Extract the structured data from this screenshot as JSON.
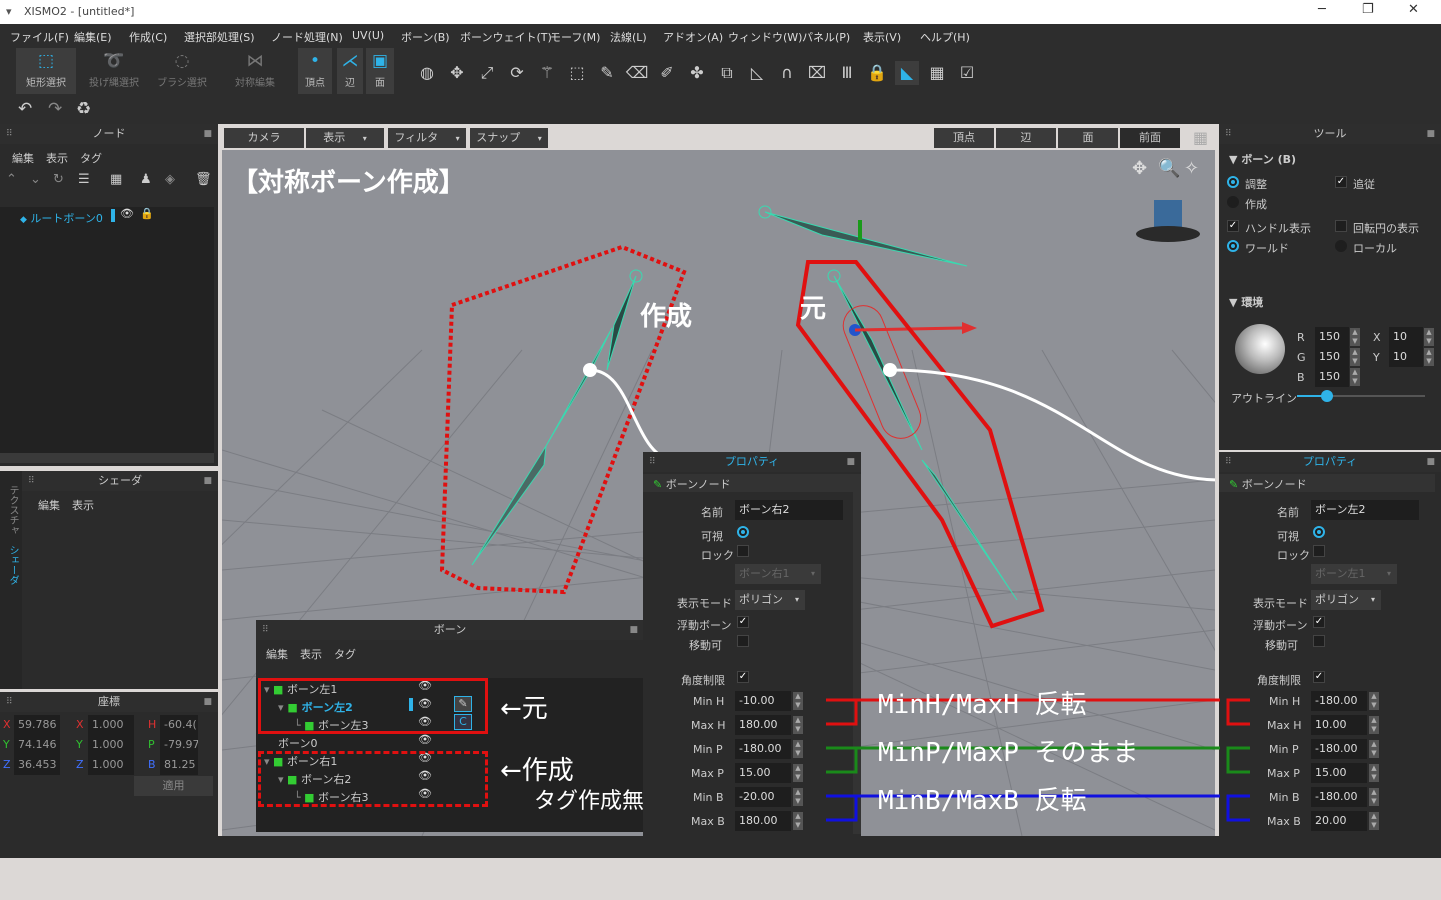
{
  "window": {
    "title": "XISMO2 - [untitled*]",
    "minimize": "─",
    "maximize": "❐",
    "close": "✕"
  },
  "menu": [
    "ファイル(F)",
    "編集(E)",
    "作成(C)",
    "選択部処理(S)",
    "ノード処理(N)",
    "UV(U)",
    "ボーン(B)",
    "ボーンウェイト(T)",
    "モーフ(M)",
    "法線(L)",
    "アドオン(A)",
    "ウィンドウ(W)",
    "パネル(P)",
    "表示(V)",
    "ヘルプ(H)"
  ],
  "toolbar": {
    "rect_select": "矩形選択",
    "lasso_select": "投げ縄選択",
    "brush_select": "ブラシ選択",
    "sym_edit": "対称編集",
    "vertex": "頂点",
    "edge": "辺",
    "face": "面"
  },
  "node_panel": {
    "title": "ノード",
    "menu": [
      "編集",
      "表示",
      "タグ"
    ],
    "root": "ルートボーン0"
  },
  "shader_panel": {
    "title": "シェーダ",
    "menu": [
      "編集",
      "表示"
    ],
    "side_tabs": [
      "テクスチャ",
      "シェーダ"
    ]
  },
  "coord_panel": {
    "title": "座標",
    "rows": [
      [
        "X",
        "59.786",
        "X",
        "1.000",
        "H",
        "-60.4("
      ],
      [
        "Y",
        "74.146",
        "Y",
        "1.000",
        "P",
        "-79.97"
      ],
      [
        "Z",
        "36.453",
        "Z",
        "1.000",
        "B",
        "81.25"
      ]
    ],
    "apply": "適用"
  },
  "viewport": {
    "tabs": {
      "camera": "カメラ",
      "display": "表示",
      "filter": "フィルタ",
      "snap": "スナップ",
      "vertex": "頂点",
      "edge": "辺",
      "face": "面",
      "front": "前面"
    },
    "heading": "【対称ボーン作成】",
    "label_created": "作成",
    "label_original": "元"
  },
  "bone_panel": {
    "title": "ボーン",
    "menu": [
      "編集",
      "表示",
      "タグ"
    ],
    "rows": [
      "ボーン左1",
      "ボーン左2",
      "ボーン左3",
      "ボーン0",
      "ボーン右1",
      "ボーン右2",
      "ボーン右3"
    ],
    "note_original": "←元",
    "note_created": "←作成",
    "note_notag": "タグ作成無し"
  },
  "tool_panel": {
    "title": "ツール",
    "bone_section": "ボーン (B)",
    "adjust": "調整",
    "follow": "追従",
    "create": "作成",
    "handle": "ハンドル表示",
    "rotcircle": "回転円の表示",
    "world": "ワールド",
    "local": "ローカル",
    "env": "環境",
    "outline": "アウトライン",
    "r": "R",
    "g": "G",
    "b": "B",
    "rv": "150",
    "gv": "150",
    "bv": "150",
    "x": "X",
    "y": "Y",
    "xv": "10",
    "yv": "10"
  },
  "props_mid": {
    "title": "プロパティ",
    "node": "ボーンノード",
    "name_label": "名前",
    "name": "ボーン右2",
    "visible": "可視",
    "lock": "ロック",
    "parent": "ボーン右1",
    "mode_label": "表示モード",
    "mode": "ポリゴン",
    "float": "浮動ボーン",
    "movable": "移動可",
    "limit": "角度制限",
    "minh": "-10.00",
    "maxh": "180.00",
    "minp": "-180.00",
    "maxp": "15.00",
    "minb": "-20.00",
    "maxb": "180.00"
  },
  "props_right": {
    "title": "プロパティ",
    "node": "ボーンノード",
    "name_label": "名前",
    "name": "ボーン左2",
    "visible": "可視",
    "lock": "ロック",
    "parent": "ボーン左1",
    "mode_label": "表示モード",
    "mode": "ポリゴン",
    "float": "浮動ボーン",
    "movable": "移動可",
    "limit": "角度制限",
    "minh": "-180.00",
    "maxh": "10.00",
    "minp": "-180.00",
    "maxp": "15.00",
    "minb": "-180.00",
    "maxb": "20.00"
  },
  "limit_labels": {
    "minh": "Min H",
    "maxh": "Max H",
    "minp": "Min P",
    "maxp": "Max P",
    "minb": "Min B",
    "maxb": "Max B"
  },
  "annotations": {
    "h": "MinH/MaxH 反転",
    "p": "MinP/MaxP そのまま",
    "b": "MinB/MaxB 反転"
  },
  "colors": {
    "accent": "#2fb3e8",
    "red": "#e01010",
    "green": "#1a8a1a",
    "blue": "#1010e0",
    "bone": "#3ad9b0"
  }
}
